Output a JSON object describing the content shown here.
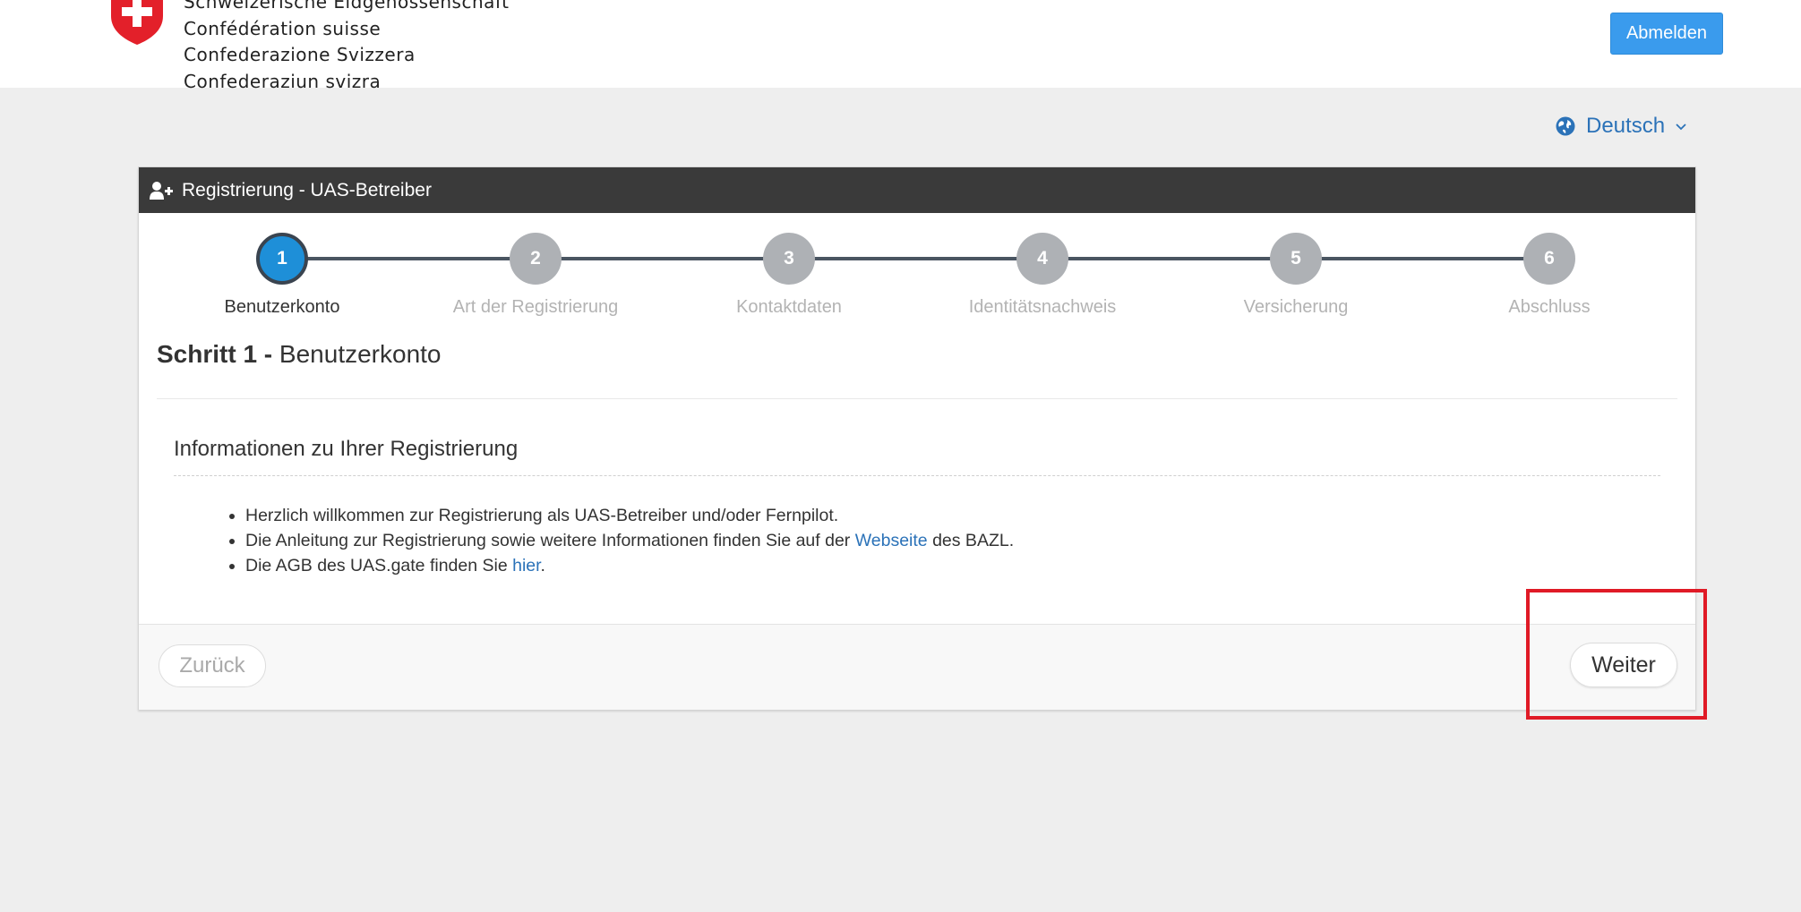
{
  "header": {
    "confederation_lines": [
      "Schweizerische Eidgenossenschaft",
      "Confédération suisse",
      "Confederazione Svizzera",
      "Confederaziun svizra"
    ],
    "logout_label": "Abmelden"
  },
  "language": {
    "selected": "Deutsch",
    "icon": "globe-icon"
  },
  "panel": {
    "title": "Registrierung - UAS-Betreiber",
    "title_icon": "add-user-icon",
    "steps": [
      {
        "number": "1",
        "label": "Benutzerkonto",
        "active": true
      },
      {
        "number": "2",
        "label": "Art der Registrierung",
        "active": false
      },
      {
        "number": "3",
        "label": "Kontaktdaten",
        "active": false
      },
      {
        "number": "4",
        "label": "Identitätsnachweis",
        "active": false
      },
      {
        "number": "5",
        "label": "Versicherung",
        "active": false
      },
      {
        "number": "6",
        "label": "Abschluss",
        "active": false
      }
    ],
    "step_heading_prefix": "Schritt 1",
    "step_heading_separator": " - ",
    "step_heading_name": "Benutzerkonto",
    "section_title": "Informationen zu Ihrer Registrierung",
    "info": {
      "item1": "Herzlich willkommen zur Registrierung als UAS-Betreiber und/oder Fernpilot.",
      "item2_pre": "Die Anleitung zur Registrierung sowie weitere Informationen finden Sie auf der ",
      "item2_link": "Webseite",
      "item2_post": " des BAZL.",
      "item3_pre": "Die AGB des UAS.gate finden Sie ",
      "item3_link": "hier",
      "item3_post": "."
    },
    "back_label": "Zurück",
    "next_label": "Weiter"
  },
  "colors": {
    "accent": "#3a9bed",
    "active_step": "#1e8fd8",
    "link": "#2b72b8",
    "highlight": "#e01a26"
  }
}
